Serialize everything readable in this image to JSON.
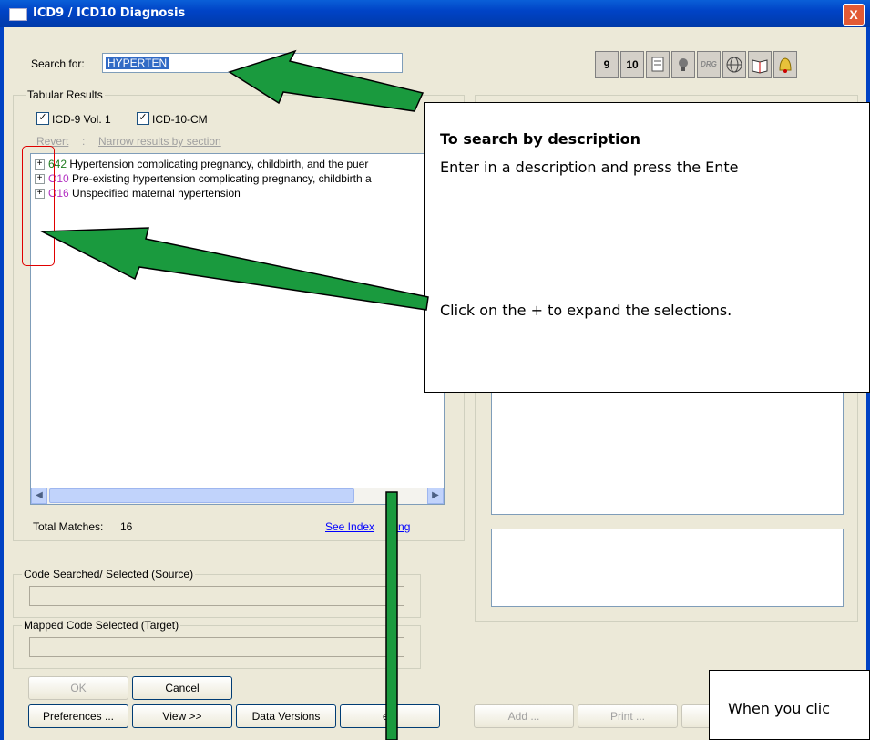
{
  "window": {
    "title": "ICD9 / ICD10 Diagnosis",
    "close_glyph": "X"
  },
  "search": {
    "label": "Search for:",
    "value": "HYPERTEN"
  },
  "toolbar": {
    "btn_9": "9",
    "btn_10": "10",
    "icons": [
      "notes-icon",
      "lightbulb-icon",
      "drg-icon",
      "globe-icon",
      "book-icon",
      "bell-icon"
    ],
    "drg_text": "DRG"
  },
  "tabular": {
    "group_label": "Tabular Results",
    "cb_icd9": "ICD-9 Vol. 1",
    "cb_icd10": "ICD-10-CM",
    "revert": "Revert",
    "separator": ":",
    "narrow": "Narrow results by section",
    "items": [
      {
        "code": "642",
        "desc": " Hypertension complicating pregnancy, childbirth, and the puer",
        "color": "#1d7c1d"
      },
      {
        "code": "O10",
        "desc": " Pre-existing hypertension complicating pregnancy, childbirth a",
        "color": "#b22fc1"
      },
      {
        "code": "O16",
        "desc": " Unspecified maternal hypertension",
        "color": "#b22fc1"
      }
    ],
    "total_label": "Total Matches:",
    "total_value": "16",
    "see_index": "See Index",
    "see_index_tail": "sting"
  },
  "source": {
    "label": "Code Searched/ Selected (Source)"
  },
  "target": {
    "label": "Mapped Code Selected (Target)"
  },
  "buttons": {
    "ok": "OK",
    "cancel": "Cancel",
    "preferences": "Preferences ...",
    "view": "View >>",
    "data_versions": "Data Versions",
    "help": "elp",
    "add": "Add ...",
    "print": "Print ..."
  },
  "callouts": {
    "heading": "To search by description",
    "line1": "Enter in a description and press the Ente",
    "line2": "Click on the + to expand the selections.",
    "bottom": "When you clic"
  },
  "colors": {
    "arrow": "#1a9a3e",
    "highlight": "#e00000",
    "link": "#0000ff"
  }
}
